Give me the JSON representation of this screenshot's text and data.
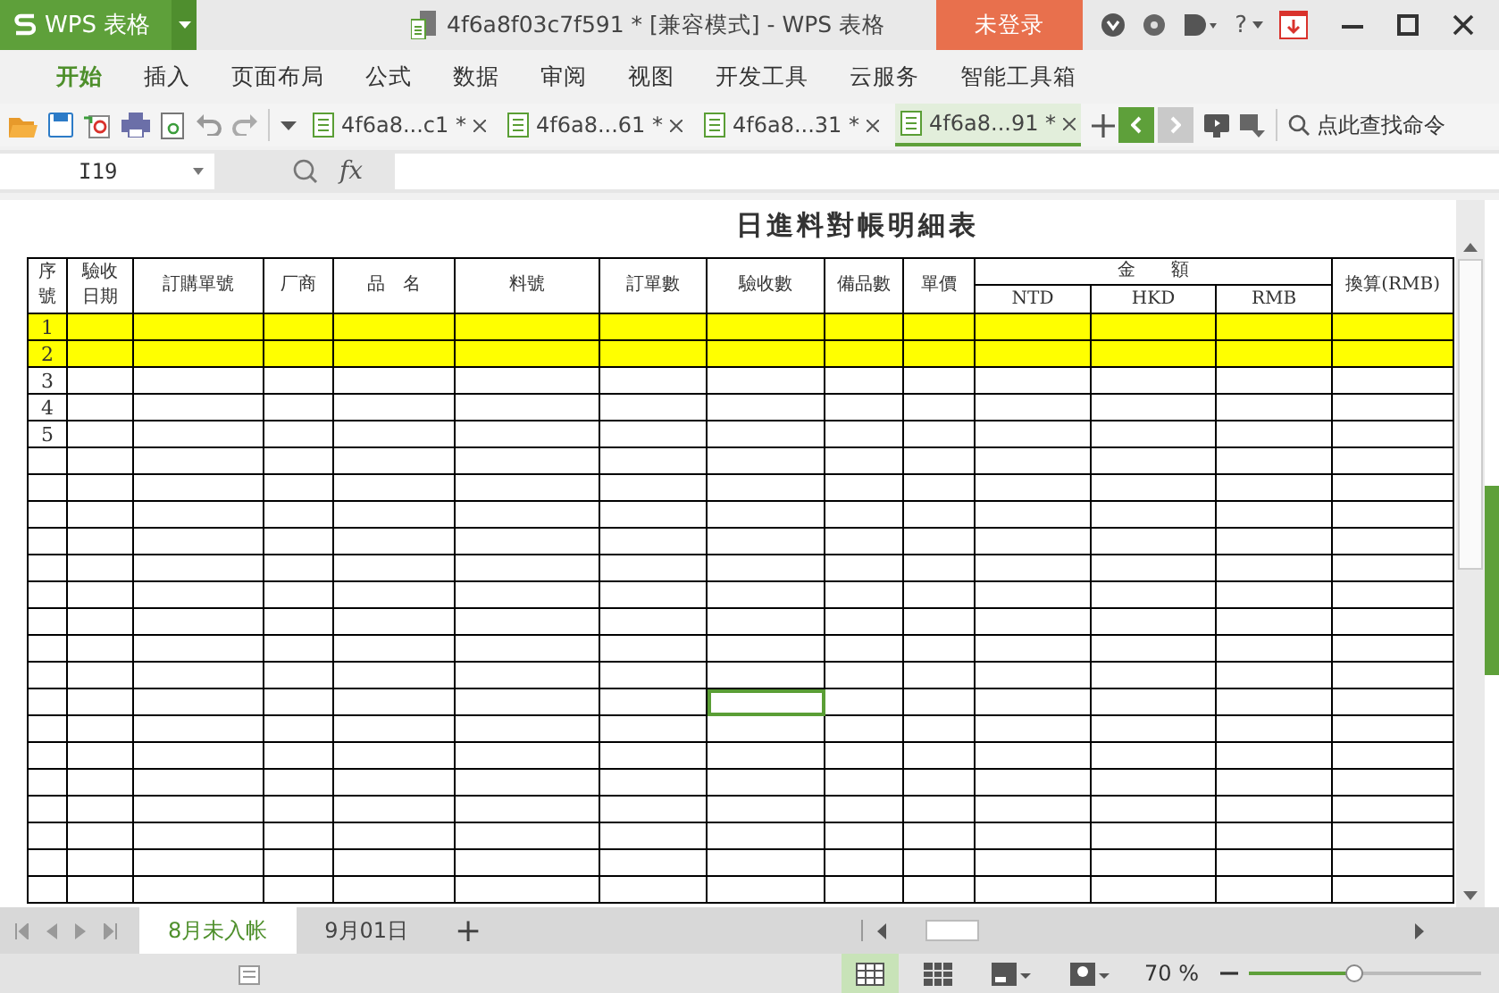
{
  "app": {
    "logo": "WPS 表格",
    "title": "4f6a8f03c7f591 * [兼容模式] - WPS 表格",
    "login": "未登录",
    "help": "?"
  },
  "menu": [
    {
      "label": "开始",
      "selected": true
    },
    {
      "label": "插入",
      "selected": false
    },
    {
      "label": "页面布局",
      "selected": false
    },
    {
      "label": "公式",
      "selected": false
    },
    {
      "label": "数据",
      "selected": false
    },
    {
      "label": "审阅",
      "selected": false
    },
    {
      "label": "视图",
      "selected": false
    },
    {
      "label": "开发工具",
      "selected": false
    },
    {
      "label": "云服务",
      "selected": false
    },
    {
      "label": "智能工具箱",
      "selected": false
    }
  ],
  "doc_tabs": [
    {
      "label": "4f6a8...c1 *",
      "selected": false
    },
    {
      "label": "4f6a8...61 *",
      "selected": false
    },
    {
      "label": "4f6a8...31 *",
      "selected": false
    },
    {
      "label": "4f6a8...91 *",
      "selected": true
    }
  ],
  "search": {
    "placeholder": "点此查找命令"
  },
  "formula_bar": {
    "cell": "I19",
    "fx": "fx"
  },
  "sheet": {
    "title": "日進料對帳明細表",
    "group": "金　　額",
    "columns": [
      {
        "label": "序號",
        "kind": "single",
        "active": false
      },
      {
        "label": "驗收日期",
        "kind": "single",
        "active": false
      },
      {
        "label": "訂購單號",
        "kind": "single",
        "active": false
      },
      {
        "label": "厂商",
        "kind": "single",
        "active": false
      },
      {
        "label": "品　名",
        "kind": "single",
        "active": false
      },
      {
        "label": "料號",
        "kind": "single",
        "active": false
      },
      {
        "label": "訂單數",
        "kind": "single",
        "active": false
      },
      {
        "label": "驗收數",
        "kind": "single",
        "active": true
      },
      {
        "label": "備品數",
        "kind": "single",
        "active": false
      },
      {
        "label": "單價",
        "kind": "single",
        "active": false
      },
      {
        "label": "NTD",
        "kind": "sub",
        "active": false
      },
      {
        "label": "HKD",
        "kind": "sub",
        "active": false
      },
      {
        "label": "RMB",
        "kind": "sub",
        "active": false
      },
      {
        "label": "換算(RMB)",
        "kind": "single",
        "active": false
      }
    ],
    "rows": [
      {
        "seq": "1",
        "highlighted": true,
        "active": false
      },
      {
        "seq": "2",
        "highlighted": true,
        "active": false
      },
      {
        "seq": "3",
        "highlighted": false,
        "active": false
      },
      {
        "seq": "4",
        "highlighted": false,
        "active": false
      },
      {
        "seq": "5",
        "highlighted": false,
        "active": false
      },
      {
        "highlighted": false,
        "active": false
      },
      {
        "highlighted": false,
        "active": false
      },
      {
        "highlighted": false,
        "active": false
      },
      {
        "highlighted": false,
        "active": false
      },
      {
        "highlighted": false,
        "active": false
      },
      {
        "highlighted": false,
        "active": false
      },
      {
        "highlighted": false,
        "active": false
      },
      {
        "highlighted": false,
        "active": false
      },
      {
        "highlighted": false,
        "active": false
      },
      {
        "highlighted": false,
        "active": true
      },
      {
        "highlighted": false,
        "active": false
      },
      {
        "highlighted": false,
        "active": false
      },
      {
        "highlighted": false,
        "active": false
      },
      {
        "highlighted": false,
        "active": false
      },
      {
        "highlighted": false,
        "active": false
      },
      {
        "highlighted": false,
        "active": false
      },
      {
        "highlighted": false,
        "active": false
      }
    ]
  },
  "sheet_tabs": [
    {
      "label": "8月未入帐",
      "selected": true
    },
    {
      "label": "9月01日",
      "selected": false
    }
  ],
  "add_sheet": "+",
  "status": {
    "zoom": "70 %",
    "zoom_level": {
      "level": 0.45
    }
  }
}
